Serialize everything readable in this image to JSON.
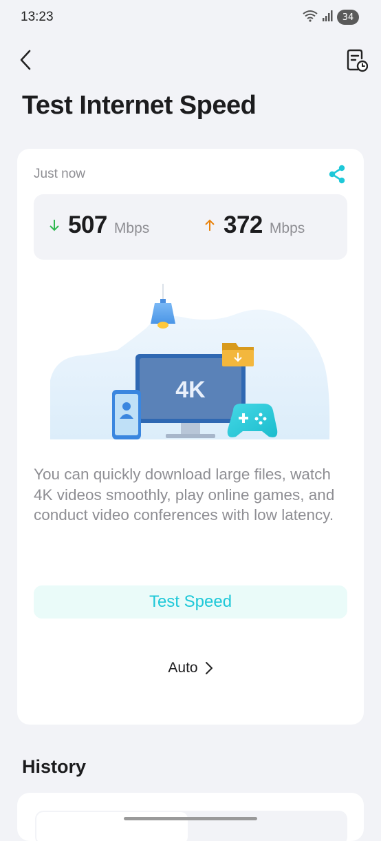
{
  "status_bar": {
    "time": "13:23",
    "battery": "34",
    "icons": [
      "wifi-icon",
      "signal-icon",
      "battery-icon"
    ]
  },
  "header": {
    "back_icon": "chevron-left-icon",
    "report_icon": "history-report-icon",
    "title": "Test Internet Speed"
  },
  "result_card": {
    "timestamp": "Just now",
    "share_icon": "share-icon",
    "download": {
      "value": "507",
      "unit": "Mbps",
      "icon": "arrow-down-icon",
      "color": "#2fb84f"
    },
    "upload": {
      "value": "372",
      "unit": "Mbps",
      "icon": "arrow-up-icon",
      "color": "#e8820c"
    },
    "illustration": {
      "screen_text": "4K"
    },
    "description": "You can quickly download large files, watch 4K videos smoothly, play online games, and conduct video conferences with low latency.",
    "test_button": "Test Speed",
    "mode": "Auto"
  },
  "history": {
    "title": "History"
  },
  "colors": {
    "accent": "#1ec8d8",
    "page_background": "#f2f3f7",
    "card_background": "#ffffff"
  }
}
